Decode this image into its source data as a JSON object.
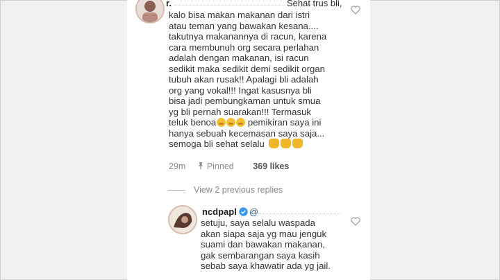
{
  "comment1": {
    "username": "r.",
    "text_lines": [
      "kalo bisa makan makanan dari istri",
      "atau teman yang bawakan kesana....",
      "takutnya makanannya di racun, karena",
      "cara membunuh org secara perlahan",
      "adalah dengan makanan, isi racun",
      "sedikit maka sedikit demi sedikit organ",
      "tubuh akan rusak!! Apalagi bli adalah",
      "org yang vokal!!! Ingat kasusnya bli",
      "bisa jadi pembungkaman untuk smua",
      "yg bli pernah suarakan!!! Termasuk"
    ],
    "head_text": "Sehat trus bli,",
    "emoji_line_prefix": "teluk benoa",
    "emoji_line_suffix": " pemikiran saya ini",
    "line_12": "hanya sebuah kecemasan saya saja...",
    "last_line": "semoga bli sehat selalu",
    "time": "29m",
    "pinned_label": "Pinned",
    "likes": "369 likes",
    "like_icon": "heart-outline-icon"
  },
  "view_previous_replies": "View 2 previous replies",
  "comment2": {
    "username": "ncdpapl",
    "mention_prefix": "@",
    "text_lines": [
      "setuju, saya selalu waspada",
      "akan siapa saja yg mau jenguk",
      "suami dan bawakan makanan,",
      "gak sembarangan saya kasih",
      "sebab saya khawatir ada yg jail."
    ],
    "verified_icon": "verified-badge-icon",
    "like_icon": "heart-outline-icon"
  },
  "colors": {
    "background": "#f1f1f1",
    "panel": "#ffffff",
    "meta_text": "#8a8a8a",
    "verified": "#3897f0"
  }
}
